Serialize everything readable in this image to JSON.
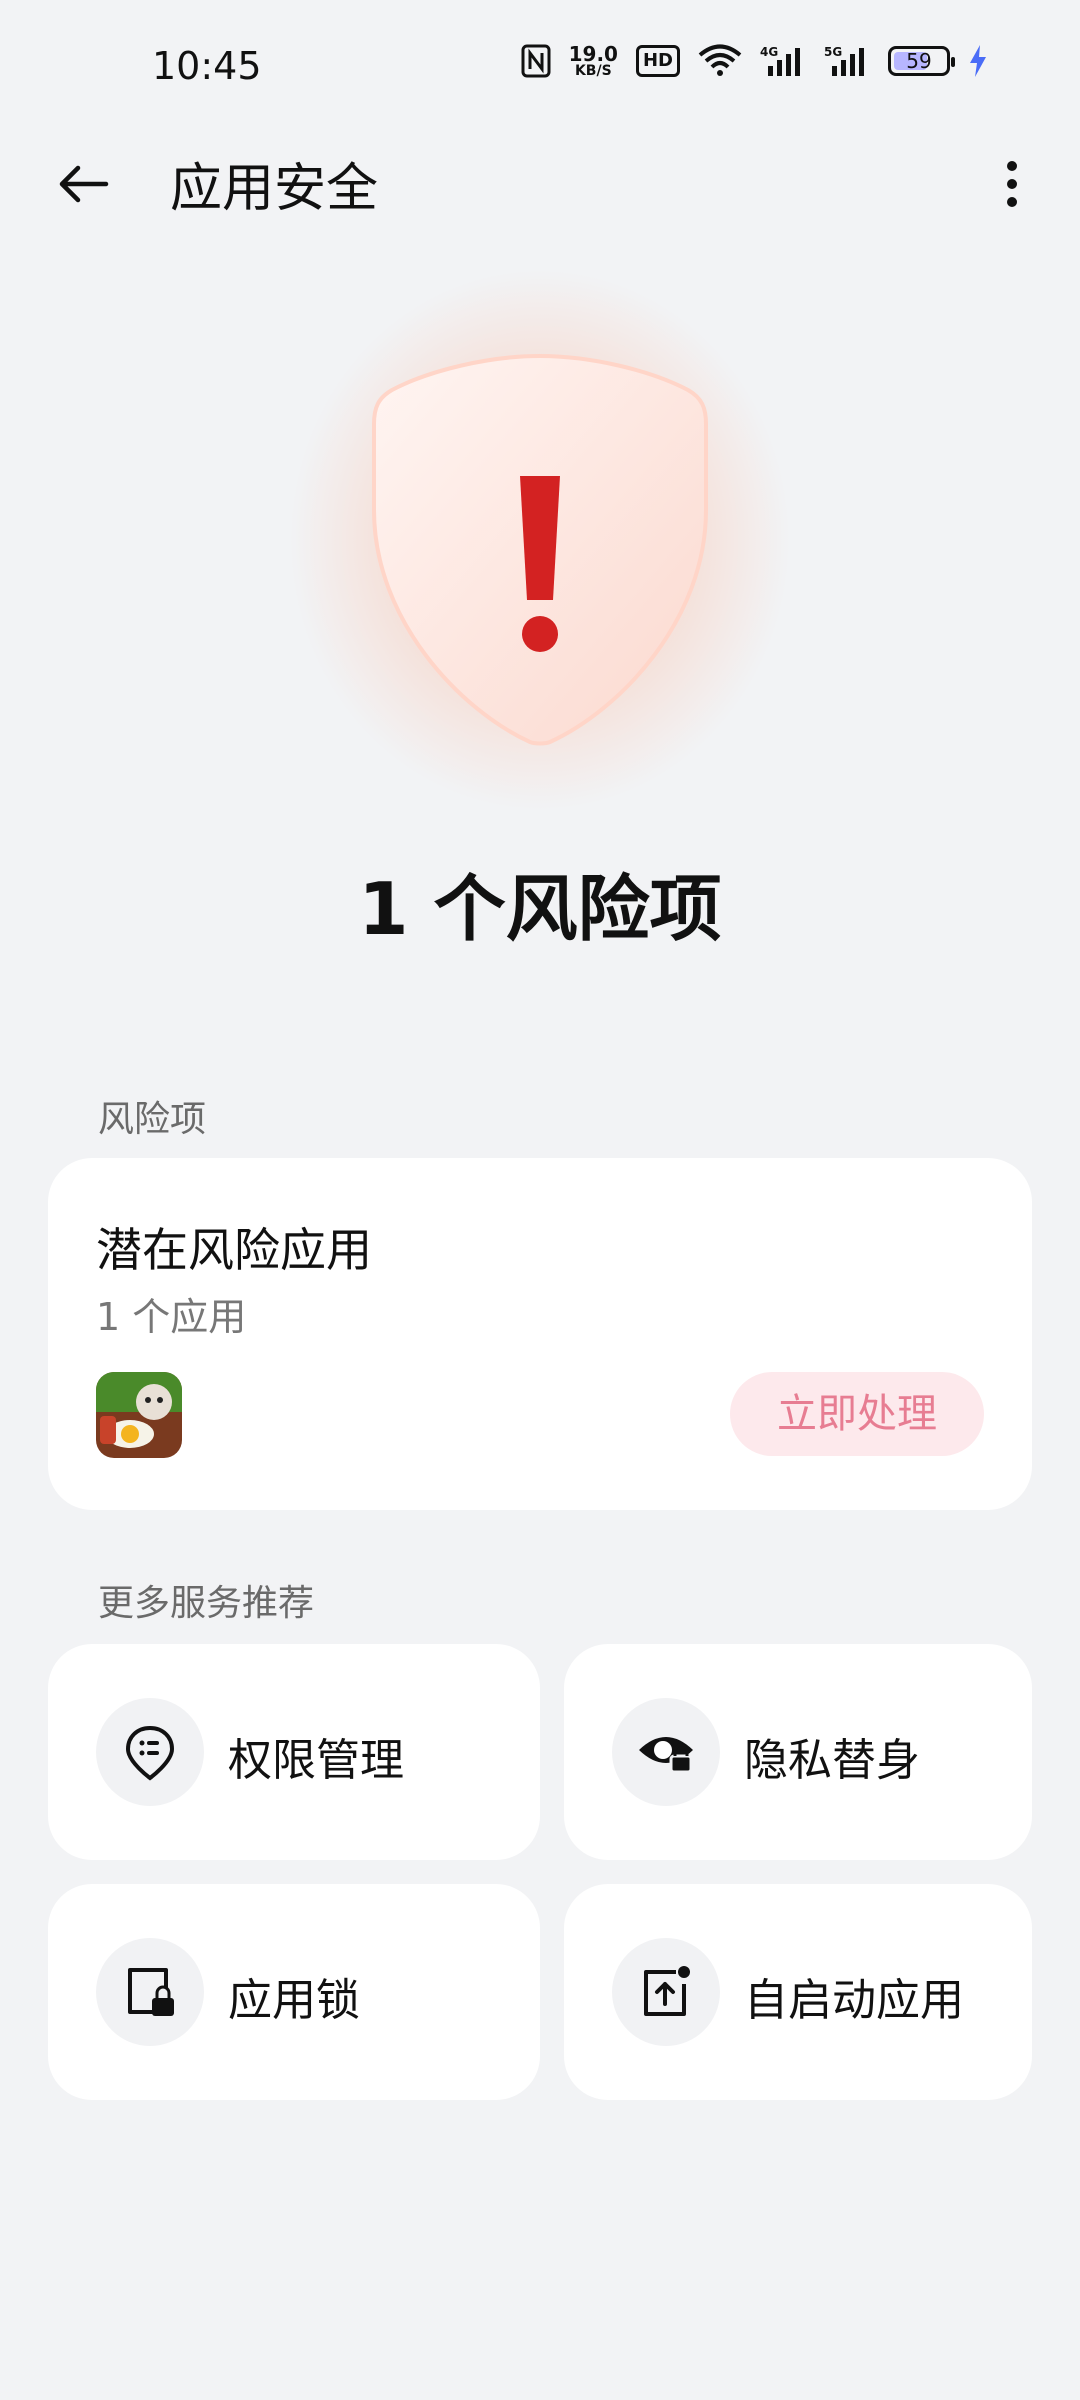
{
  "status_bar": {
    "time": "10:45",
    "speed_value": "19.0",
    "speed_unit": "KB/S",
    "hd_badge": "HD",
    "net_1": "4G",
    "net_2": "5G",
    "battery": "59"
  },
  "header": {
    "title": "应用安全"
  },
  "hero": {
    "risk_count_text": "1 个风险项",
    "accent_color": "#d32222"
  },
  "risk_section": {
    "label": "风险项",
    "card": {
      "title": "潜在风险应用",
      "subtitle": "1 个应用",
      "action": "立即处理"
    }
  },
  "services_section": {
    "label": "更多服务推荐",
    "items": [
      {
        "label": "权限管理",
        "icon": "permission-icon"
      },
      {
        "label": "隐私替身",
        "icon": "privacy-eye-icon"
      },
      {
        "label": "应用锁",
        "icon": "app-lock-icon"
      },
      {
        "label": "自启动应用",
        "icon": "auto-start-icon"
      }
    ]
  }
}
